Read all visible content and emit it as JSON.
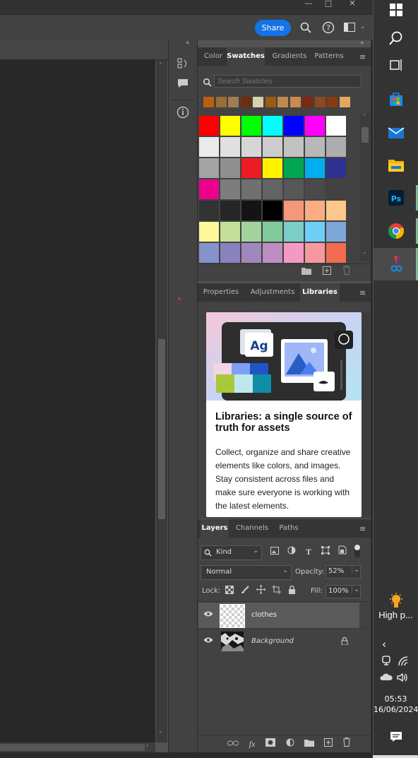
{
  "topbar": {
    "share_label": "Share"
  },
  "swatches_panel": {
    "tabs": [
      "Color",
      "Swatches",
      "Gradients",
      "Patterns"
    ],
    "search_placeholder": "Search Swatches",
    "recent": [
      "#b8620f",
      "#9a6c36",
      "#a07c53",
      "#6f2d0d",
      "#d7d0b1",
      "#9b5b17",
      "#bc8b54",
      "#c98a4f",
      "#7b2a12",
      "#8b4a1c",
      "#893a0f",
      "#e1a85e"
    ],
    "grid": [
      [
        "#ff0000",
        "#ffff00",
        "#00ff00",
        "#00ffff",
        "#0000ff",
        "#ff00ff",
        "#ffffff"
      ],
      [
        "#ebebeb",
        "#e0e0e0",
        "#d6d6d6",
        "#cccccc",
        "#c2c2c2",
        "#b8b8b8",
        "#adadad"
      ],
      [
        "#a3a3a3",
        "#8f8f8f",
        "#ed1c24",
        "#fff200",
        "#00a651",
        "#00aeef",
        "#2e3192"
      ],
      [
        "#ec008c",
        "#7d7d7d",
        "#707070",
        "#636363",
        "#575757",
        "#4a4a4a",
        "#424242"
      ],
      [
        "#333333",
        "#262626",
        "#141414",
        "#000000",
        "#f7977a",
        "#f9ad81",
        "#fdc68a"
      ],
      [
        "#fff79a",
        "#c4df9b",
        "#a3d39c",
        "#82ca9d",
        "#7bcdc8",
        "#6ecff6",
        "#7ea7d8"
      ],
      [
        "#8493ca",
        "#8882be",
        "#a187be",
        "#bc8dbf",
        "#f49ac2",
        "#f6989d",
        "#f26c4f"
      ]
    ]
  },
  "properties_panel": {
    "tabs": [
      "Properties",
      "Adjustments",
      "Libraries"
    ],
    "card_title": "Libraries: a single source of truth for assets",
    "card_body": "Collect, organize and share creative elements like colors, and images. Stay consistent across files and make sure everyone is working with the latest elements.",
    "art_text": "Ag"
  },
  "layers_panel": {
    "tabs": [
      "Layers",
      "Channels",
      "Paths"
    ],
    "filter_kind": "Kind",
    "blend_mode": "Normal",
    "opacity_label": "Opacity:",
    "opacity_value": "52%",
    "lock_label": "Lock:",
    "fill_label": "Fill:",
    "fill_value": "100%",
    "layers": [
      {
        "name": "clothes"
      },
      {
        "name": "Background"
      }
    ]
  },
  "taskbar": {
    "high_label": "High p...",
    "time": "05:53",
    "date": "16/06/2024"
  },
  "colors": {
    "accent": "#1473e6",
    "panel": "#424242",
    "tabbar": "#353535"
  }
}
